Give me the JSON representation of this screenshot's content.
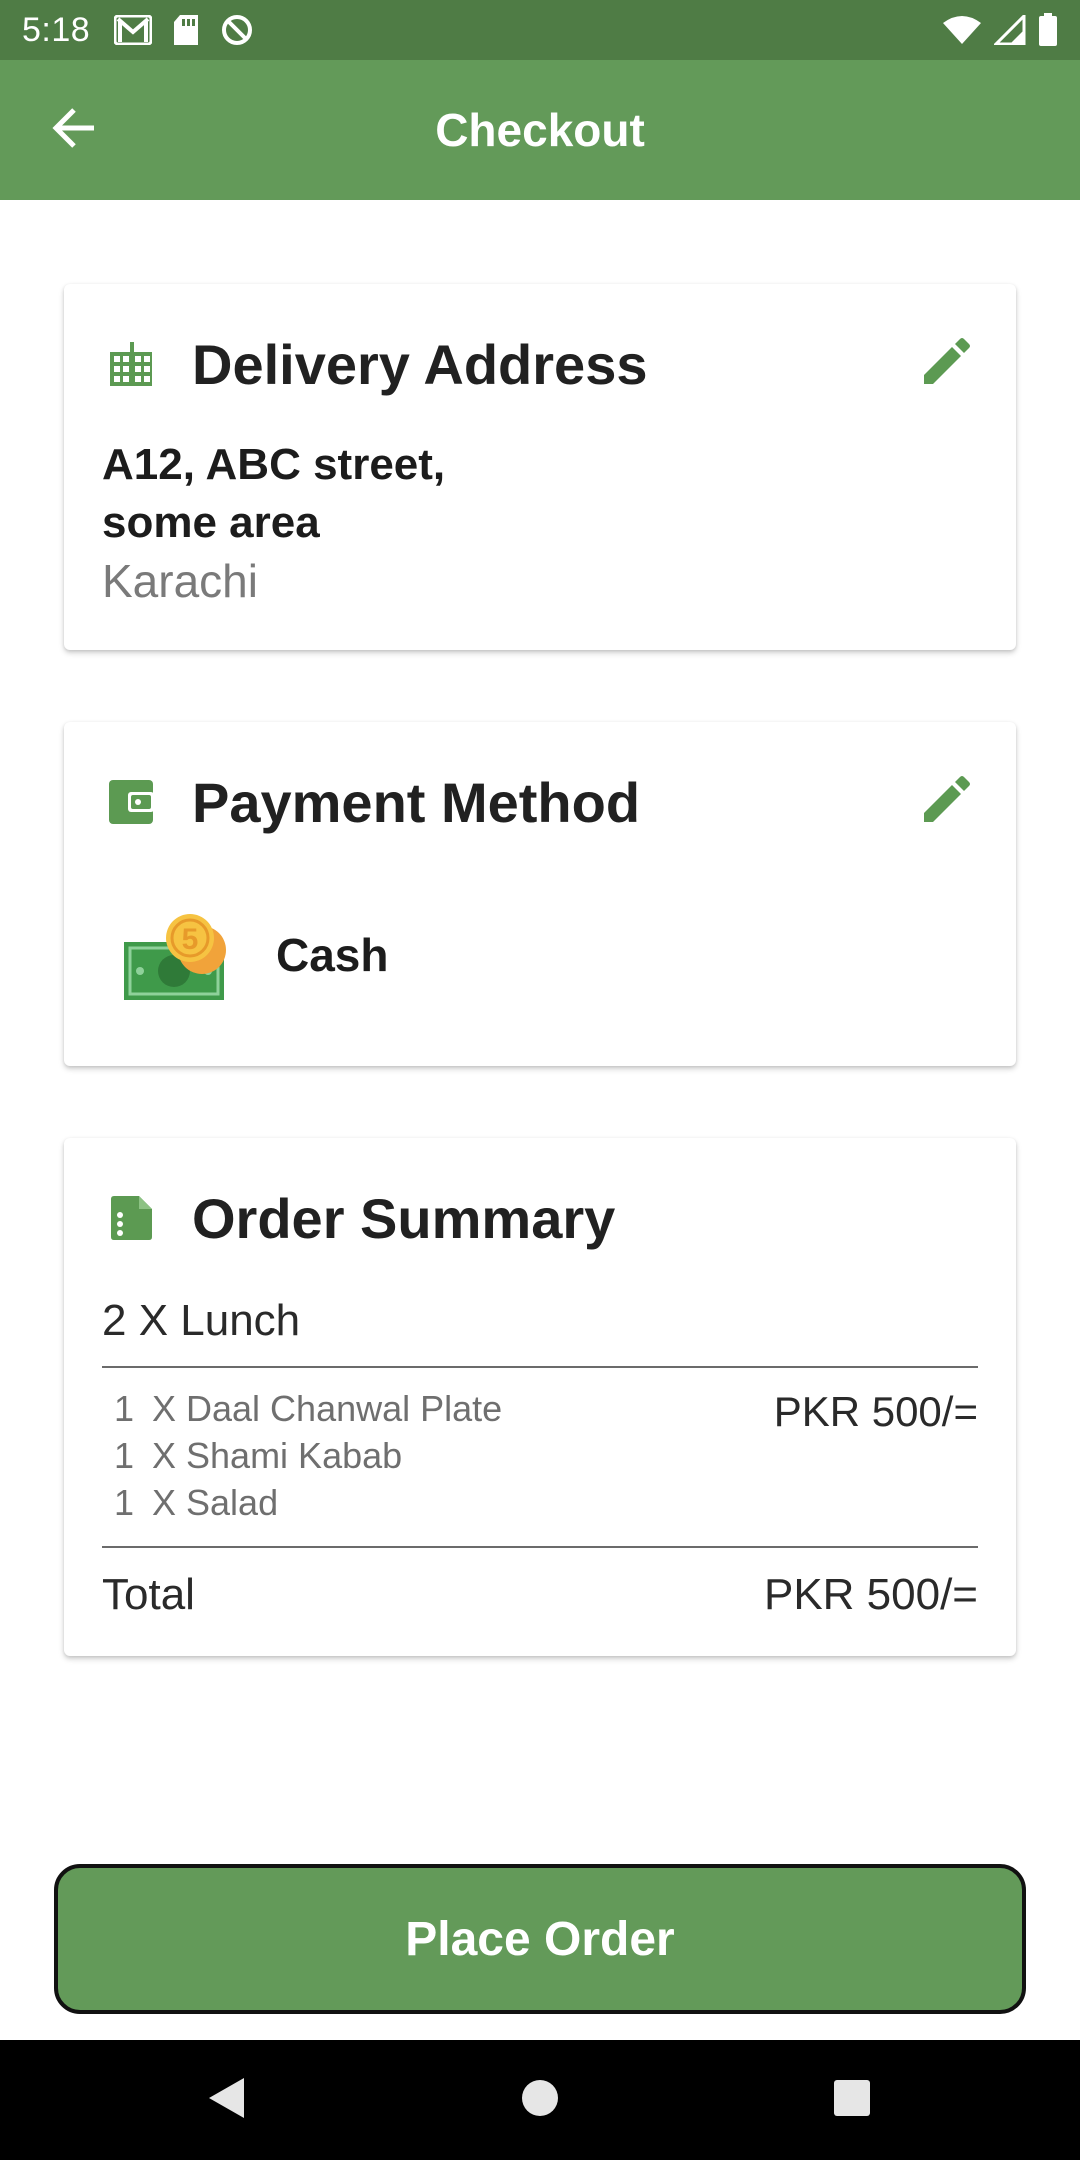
{
  "status_bar": {
    "time": "5:18",
    "left_icons": [
      "gmail-icon",
      "sd-card-icon",
      "data-saver-icon"
    ],
    "right_icons": [
      "wifi-icon",
      "signal-icon",
      "battery-icon"
    ]
  },
  "app_bar": {
    "title": "Checkout",
    "back_icon": "arrow-left-icon"
  },
  "delivery": {
    "title": "Delivery Address",
    "icon": "building-icon",
    "edit_icon": "pencil-icon",
    "address_line1": "A12, ABC street,",
    "address_line2": "some area",
    "city": "Karachi"
  },
  "payment": {
    "title": "Payment Method",
    "icon": "wallet-icon",
    "edit_icon": "pencil-icon",
    "method": "Cash",
    "method_image": "cash-money-icon",
    "coin_label": "5"
  },
  "summary": {
    "title": "Order Summary",
    "icon": "receipt-icon",
    "group": "2 X Lunch",
    "items": [
      {
        "qty": "1",
        "name": "X Daal Chanwal Plate"
      },
      {
        "qty": "1",
        "name": "X Shami Kabab"
      },
      {
        "qty": "1",
        "name": "X Salad"
      }
    ],
    "price": "PKR 500/=",
    "total_label": "Total",
    "total_value": "PKR 500/="
  },
  "actions": {
    "place_order": "Place Order"
  },
  "colors": {
    "status_bar": "#4f7c45",
    "primary": "#639a59",
    "icon_green": "#5c9a52",
    "text": "#212121",
    "muted": "#7a7a7a"
  },
  "nav": {
    "back": "nav-back-icon",
    "home": "nav-home-icon",
    "recents": "nav-recents-icon"
  }
}
